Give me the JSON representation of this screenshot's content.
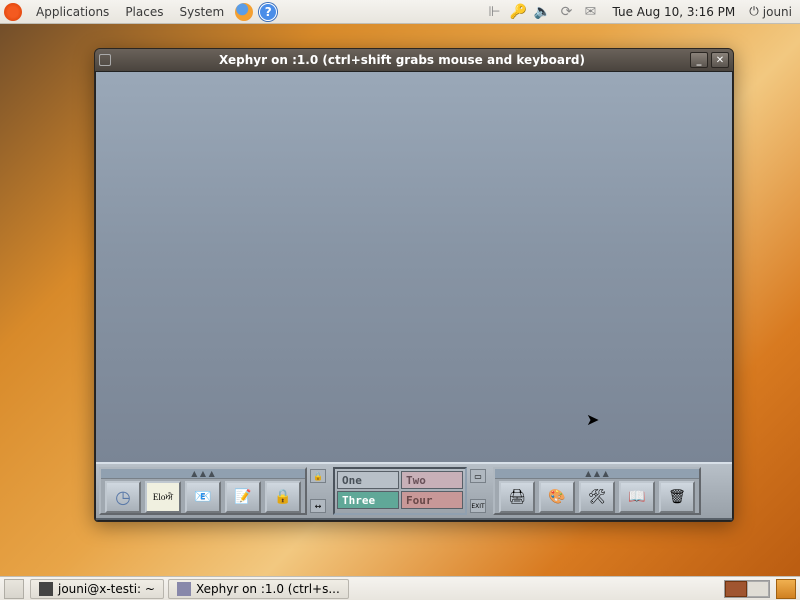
{
  "top_panel": {
    "menus": [
      "Applications",
      "Places",
      "System"
    ],
    "clock": "Tue Aug 10,  3:16 PM",
    "username": "jouni"
  },
  "bottom_panel": {
    "tasks": [
      {
        "label": "jouni@x-testi: ~"
      },
      {
        "label": "Xephyr on :1.0 (ctrl+s..."
      }
    ]
  },
  "xwindow": {
    "title": "Xephyr on :1.0 (ctrl+shift grabs mouse and keyboard)"
  },
  "fvwm": {
    "calendar_label": "Elo 10",
    "pager": {
      "one": "One",
      "two": "Two",
      "three": "Three",
      "four": "Four"
    },
    "exit_label": "EXIT"
  }
}
